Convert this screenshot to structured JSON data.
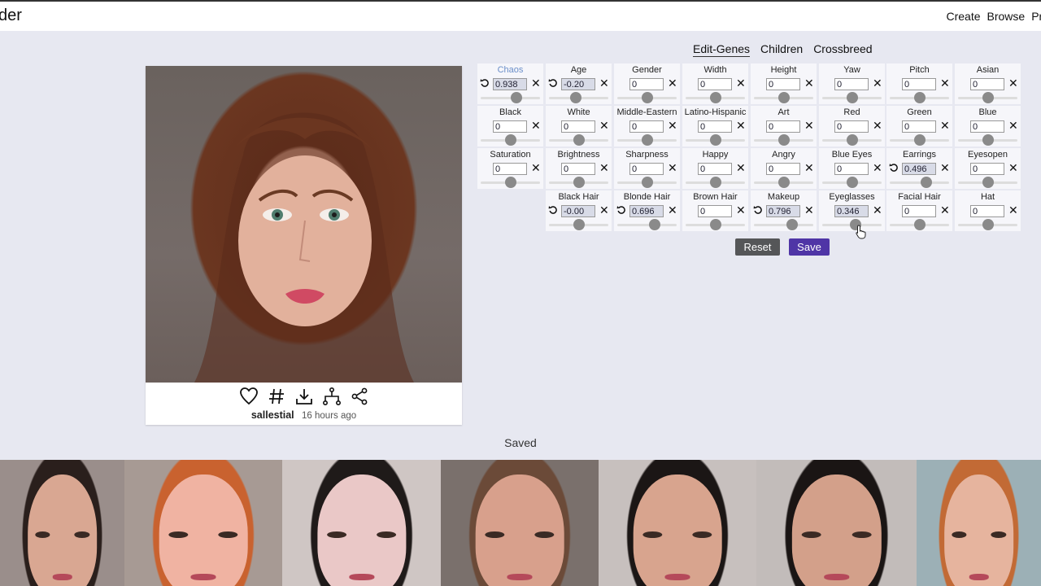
{
  "header": {
    "brand": "der",
    "nav": [
      "Create",
      "Browse",
      "Pro"
    ]
  },
  "tabs": [
    {
      "label": "Edit-Genes",
      "active": true
    },
    {
      "label": "Children",
      "active": false
    },
    {
      "label": "Crossbreed",
      "active": false
    }
  ],
  "card": {
    "username": "sallestial",
    "time": "16 hours ago",
    "actions": [
      "heart-icon",
      "hash-icon",
      "download-icon",
      "tree-icon",
      "share-icon"
    ]
  },
  "genes": [
    {
      "name": "Chaos",
      "value": "0.938",
      "level": 0.6,
      "modified": true
    },
    {
      "name": "Age",
      "value": "-0.20",
      "level": 0.45,
      "modified": true
    },
    {
      "name": "Gender",
      "value": "0",
      "level": 0.5,
      "modified": false
    },
    {
      "name": "Width",
      "value": "0",
      "level": 0.5,
      "modified": false
    },
    {
      "name": "Height",
      "value": "0",
      "level": 0.5,
      "modified": false
    },
    {
      "name": "Yaw",
      "value": "0",
      "level": 0.5,
      "modified": false
    },
    {
      "name": "Pitch",
      "value": "0",
      "level": 0.5,
      "modified": false
    },
    {
      "name": "Asian",
      "value": "0",
      "level": 0.5,
      "modified": false
    },
    {
      "name": "Black",
      "value": "0",
      "level": 0.5,
      "modified": false
    },
    {
      "name": "White",
      "value": "0",
      "level": 0.5,
      "modified": false
    },
    {
      "name": "Middle-Eastern",
      "value": "0",
      "level": 0.5,
      "modified": false
    },
    {
      "name": "Latino-Hispanic",
      "value": "0",
      "level": 0.5,
      "modified": false
    },
    {
      "name": "Art",
      "value": "0",
      "level": 0.5,
      "modified": false
    },
    {
      "name": "Red",
      "value": "0",
      "level": 0.5,
      "modified": false
    },
    {
      "name": "Green",
      "value": "0",
      "level": 0.5,
      "modified": false
    },
    {
      "name": "Blue",
      "value": "0",
      "level": 0.5,
      "modified": false
    },
    {
      "name": "Saturation",
      "value": "0",
      "level": 0.5,
      "modified": false
    },
    {
      "name": "Brightness",
      "value": "0",
      "level": 0.5,
      "modified": false
    },
    {
      "name": "Sharpness",
      "value": "0",
      "level": 0.5,
      "modified": false
    },
    {
      "name": "Happy",
      "value": "0",
      "level": 0.5,
      "modified": false
    },
    {
      "name": "Angry",
      "value": "0",
      "level": 0.5,
      "modified": false
    },
    {
      "name": "Blue Eyes",
      "value": "0",
      "level": 0.5,
      "modified": false
    },
    {
      "name": "Earrings",
      "value": "0.496",
      "level": 0.62,
      "modified": true
    },
    {
      "name": "Eyesopen",
      "value": "0",
      "level": 0.5,
      "modified": false
    },
    {
      "name": "Black Hair",
      "value": "-0.00",
      "level": 0.5,
      "modified": true
    },
    {
      "name": "Blonde Hair",
      "value": "0.696",
      "level": 0.63,
      "modified": true
    },
    {
      "name": "Brown Hair",
      "value": "0",
      "level": 0.5,
      "modified": false
    },
    {
      "name": "Makeup",
      "value": "0.796",
      "level": 0.64,
      "modified": true
    },
    {
      "name": "Eyeglasses",
      "value": "0.346",
      "level": 0.56,
      "modified": false
    },
    {
      "name": "Facial Hair",
      "value": "0",
      "level": 0.5,
      "modified": false
    },
    {
      "name": "Hat",
      "value": "0",
      "level": 0.5,
      "modified": false
    }
  ],
  "buttons": {
    "reset": "Reset",
    "save": "Save"
  },
  "saved": {
    "label": "Saved",
    "items": [
      {
        "hair": "#2a1f1c",
        "skin": "#d9a792",
        "bg": "#9a8e8b"
      },
      {
        "hair": "#c9622f",
        "skin": "#f0b3a2",
        "bg": "#a79a94"
      },
      {
        "hair": "#1f1a19",
        "skin": "#eac8c7",
        "bg": "#cfc6c4"
      },
      {
        "hair": "#6b4a38",
        "skin": "#d8a08c",
        "bg": "#7a706c"
      },
      {
        "hair": "#1b1615",
        "skin": "#d8a48e",
        "bg": "#c7c0be"
      },
      {
        "hair": "#1a1514",
        "skin": "#d3a08a",
        "bg": "#c2bcba"
      },
      {
        "hair": "#c26a35",
        "skin": "#e6b49e",
        "bg": "#9cb0b6"
      }
    ]
  }
}
